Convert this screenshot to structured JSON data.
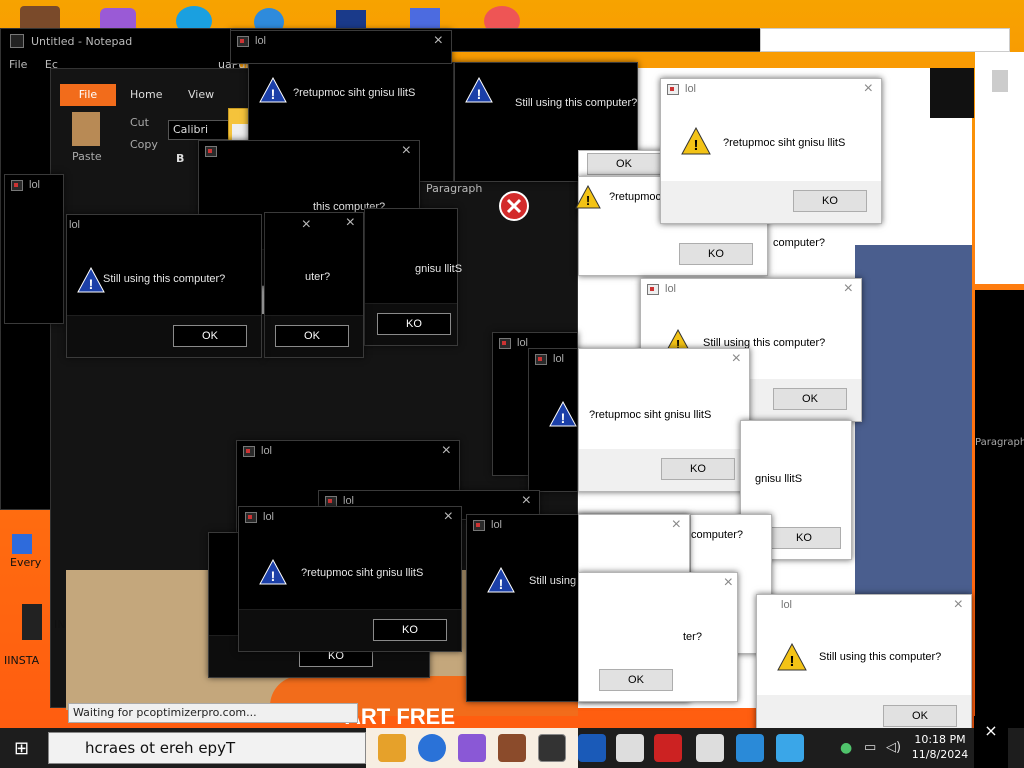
{
  "notepad": {
    "title": "Untitled - Notepad",
    "menu_file": "File",
    "menu_edit": "Ec"
  },
  "word": {
    "file_tab": "File",
    "home_tab": "Home",
    "view_tab": "View",
    "cut": "Cut",
    "copy": "Copy",
    "paste": "Paste",
    "font": "Calibri",
    "bold": "B",
    "paragraph": "Paragraph",
    "doc_title": "uaPdro"
  },
  "dialog_title": "lol",
  "msg_normal": "Still using this computer?",
  "msg_reversed": "?retupmoc siht gnisu llitS",
  "ok": "OK",
  "ko": "KO",
  "fragments": {
    "this_computer": "this computer?",
    "uter": "uter?",
    "ter": "ter?",
    "ter2": "ter?",
    "computer": "computer?",
    "nisu_llits": "gnisu llitS",
    "rmoc": "?retupmoc",
    "rer": "?ret",
    "gnisu": "gnisu llitS",
    "cut_sisu": "?retupm"
  },
  "status_text": "Waiting for pcoptimizerpro.com...",
  "banner_text": "ART FREE",
  "desktop_icons": [
    {
      "label": "Every"
    },
    {
      "label": "IINSTA"
    },
    {
      "label": "IN"
    }
  ],
  "taskbar": {
    "search_text": "hcraes ot ereh epyT",
    "time": "10:18 PM",
    "date": "11/8/2024"
  },
  "colors": {
    "accent": "#f26c1b",
    "warning_blue": "#1b3fa8",
    "warning_yellow": "#f3c316",
    "taskbar": "#1d1d1d"
  }
}
